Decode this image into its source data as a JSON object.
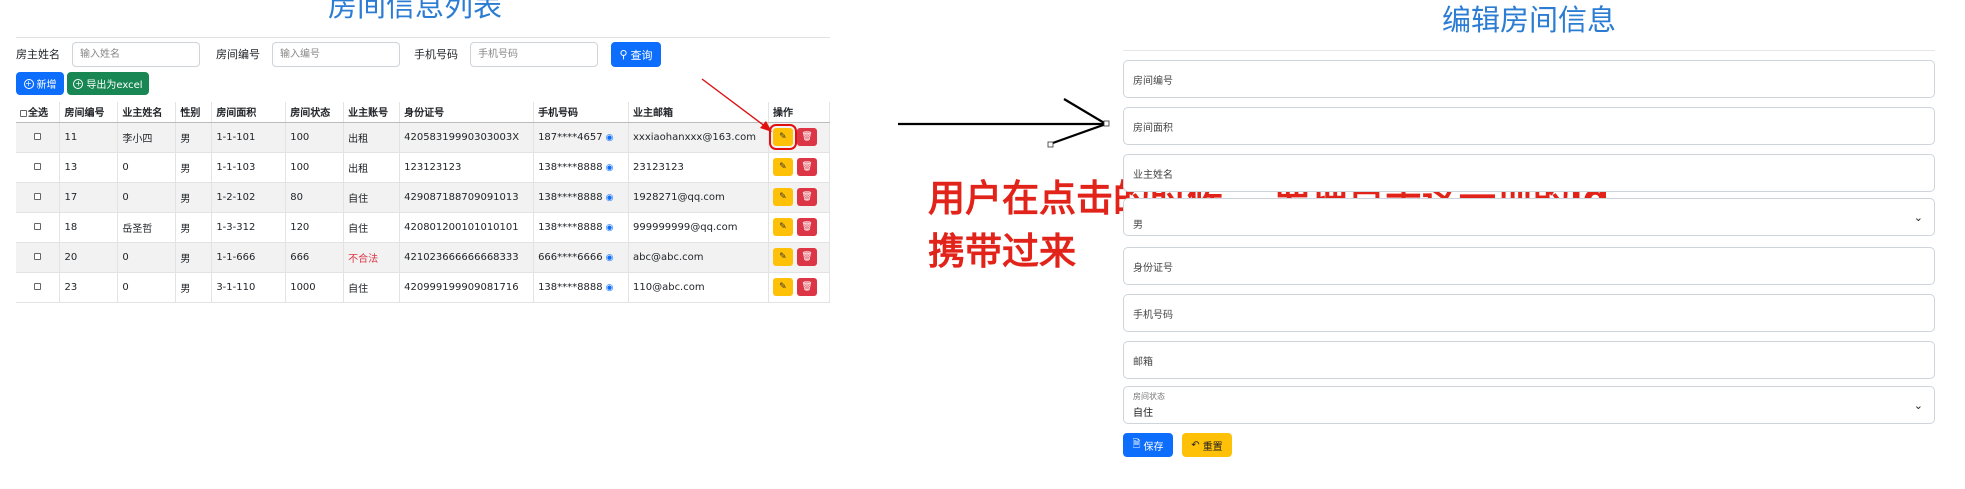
{
  "list_page": {
    "title": "房间信息列表",
    "search": {
      "owner_label": "房主姓名",
      "owner_placeholder": "输入姓名",
      "room_no_label": "房间编号",
      "room_no_placeholder": "输入编号",
      "phone_label": "手机号码",
      "phone_placeholder": "手机号码",
      "query_label": "查询"
    },
    "toolbar": {
      "add_label": "新增",
      "export_label": "导出为excel"
    },
    "table": {
      "headers": [
        "全选",
        "房间编号",
        "业主姓名",
        "性别",
        "房间面积",
        "房间状态",
        "业主账号",
        "身份证号",
        "手机号码",
        "业主邮箱",
        "操作"
      ],
      "rows": [
        {
          "id": "11",
          "owner": "李小四",
          "gender": "男",
          "room": "1-1-101",
          "area": "100",
          "state": "出租",
          "idcard": "42058319990303003X",
          "phone": "187****4657",
          "email": "xxxiaohanxxx@163.com"
        },
        {
          "id": "13",
          "owner": "0",
          "gender": "男",
          "room": "1-1-103",
          "area": "100",
          "state": "出租",
          "idcard": "123123123",
          "phone": "138****8888",
          "email": "23123123"
        },
        {
          "id": "17",
          "owner": "0",
          "gender": "男",
          "room": "1-2-102",
          "area": "80",
          "state": "自住",
          "idcard": "429087188709091013",
          "phone": "138****8888",
          "email": "1928271@qq.com"
        },
        {
          "id": "18",
          "owner": "岳圣哲",
          "gender": "男",
          "room": "1-3-312",
          "area": "120",
          "state": "自住",
          "idcard": "420801200101010101",
          "phone": "138****8888",
          "email": "999999999@qq.com"
        },
        {
          "id": "20",
          "owner": "0",
          "gender": "男",
          "room": "1-1-666",
          "area": "666",
          "state": "不合法",
          "idcard": "421023666666668333",
          "phone": "666****6666",
          "email": "abc@abc.com"
        },
        {
          "id": "23",
          "owner": "0",
          "gender": "男",
          "room": "3-1-110",
          "area": "1000",
          "state": "自住",
          "idcard": "420999199909081716",
          "phone": "138****8888",
          "email": "110@abc.com"
        }
      ]
    }
  },
  "annotation": {
    "line1": "用户在点击的时候， 要把点击这一项的id",
    "line2": "携带过来"
  },
  "edit_page": {
    "title": "编辑房间信息",
    "fields": {
      "room_no": "房间编号",
      "area": "房间面积",
      "owner": "业主姓名",
      "gender": "男",
      "idcard": "身份证号",
      "phone": "手机号码",
      "email": "邮箱",
      "state_label": "房间状态",
      "state_value": "自住"
    },
    "save_label": "保存",
    "reset_label": "重置"
  },
  "colors": {
    "title_blue": "#2b7cd3",
    "primary": "#0d6efd",
    "success": "#198754",
    "warning": "#ffc107",
    "danger": "#dc3545",
    "annotation_red": "#e2231a"
  }
}
